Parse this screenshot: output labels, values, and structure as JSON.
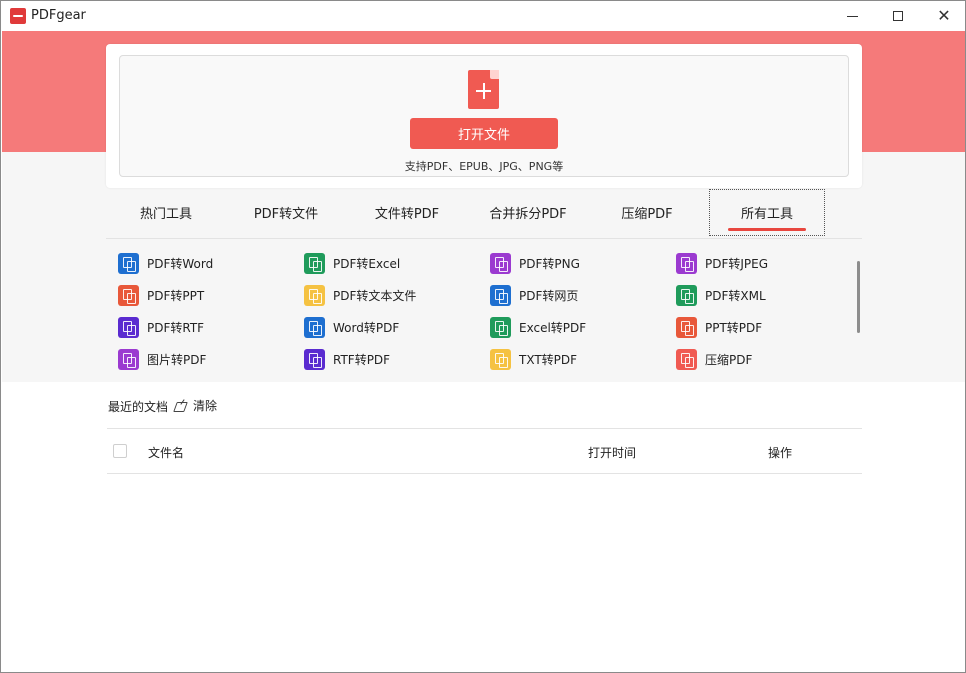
{
  "app": {
    "title": "PDFgear"
  },
  "open": {
    "button_label": "打开文件",
    "supported_formats": "支持PDF、EPUB、JPG、PNG等"
  },
  "tabs": [
    {
      "label": "热门工具"
    },
    {
      "label": "PDF转文件"
    },
    {
      "label": "文件转PDF"
    },
    {
      "label": "合并拆分PDF"
    },
    {
      "label": "压缩PDF"
    },
    {
      "label": "所有工具",
      "active": true
    }
  ],
  "tools": [
    {
      "label": "PDF转Word",
      "icon": "pdf-to-word-icon",
      "color": "#1e6fd0"
    },
    {
      "label": "PDF转Excel",
      "icon": "pdf-to-excel-icon",
      "color": "#1f9b5b"
    },
    {
      "label": "PDF转PNG",
      "icon": "pdf-to-png-icon",
      "color": "#9b3ad0"
    },
    {
      "label": "PDF转JPEG",
      "icon": "pdf-to-jpeg-icon",
      "color": "#9b3ad0"
    },
    {
      "label": "PDF转PPT",
      "icon": "pdf-to-ppt-icon",
      "color": "#e8583a"
    },
    {
      "label": "PDF转文本文件",
      "icon": "pdf-to-text-icon",
      "color": "#f5c242"
    },
    {
      "label": "PDF转网页",
      "icon": "pdf-to-html-icon",
      "color": "#1e6fd0"
    },
    {
      "label": "PDF转XML",
      "icon": "pdf-to-xml-icon",
      "color": "#1f9b5b"
    },
    {
      "label": "PDF转RTF",
      "icon": "pdf-to-rtf-icon",
      "color": "#5a2bd0"
    },
    {
      "label": "Word转PDF",
      "icon": "word-to-pdf-icon",
      "color": "#1e6fd0"
    },
    {
      "label": "Excel转PDF",
      "icon": "excel-to-pdf-icon",
      "color": "#1f9b5b"
    },
    {
      "label": "PPT转PDF",
      "icon": "ppt-to-pdf-icon",
      "color": "#e8583a"
    },
    {
      "label": "图片转PDF",
      "icon": "image-to-pdf-icon",
      "color": "#9b3ad0"
    },
    {
      "label": "RTF转PDF",
      "icon": "rtf-to-pdf-icon",
      "color": "#5a2bd0"
    },
    {
      "label": "TXT转PDF",
      "icon": "txt-to-pdf-icon",
      "color": "#f5c242"
    },
    {
      "label": "压缩PDF",
      "icon": "compress-pdf-icon",
      "color": "#f05a52"
    }
  ],
  "recent": {
    "title": "最近的文档",
    "clear_label": "清除",
    "columns": {
      "name": "文件名",
      "time": "打开时间",
      "ops": "操作"
    }
  }
}
